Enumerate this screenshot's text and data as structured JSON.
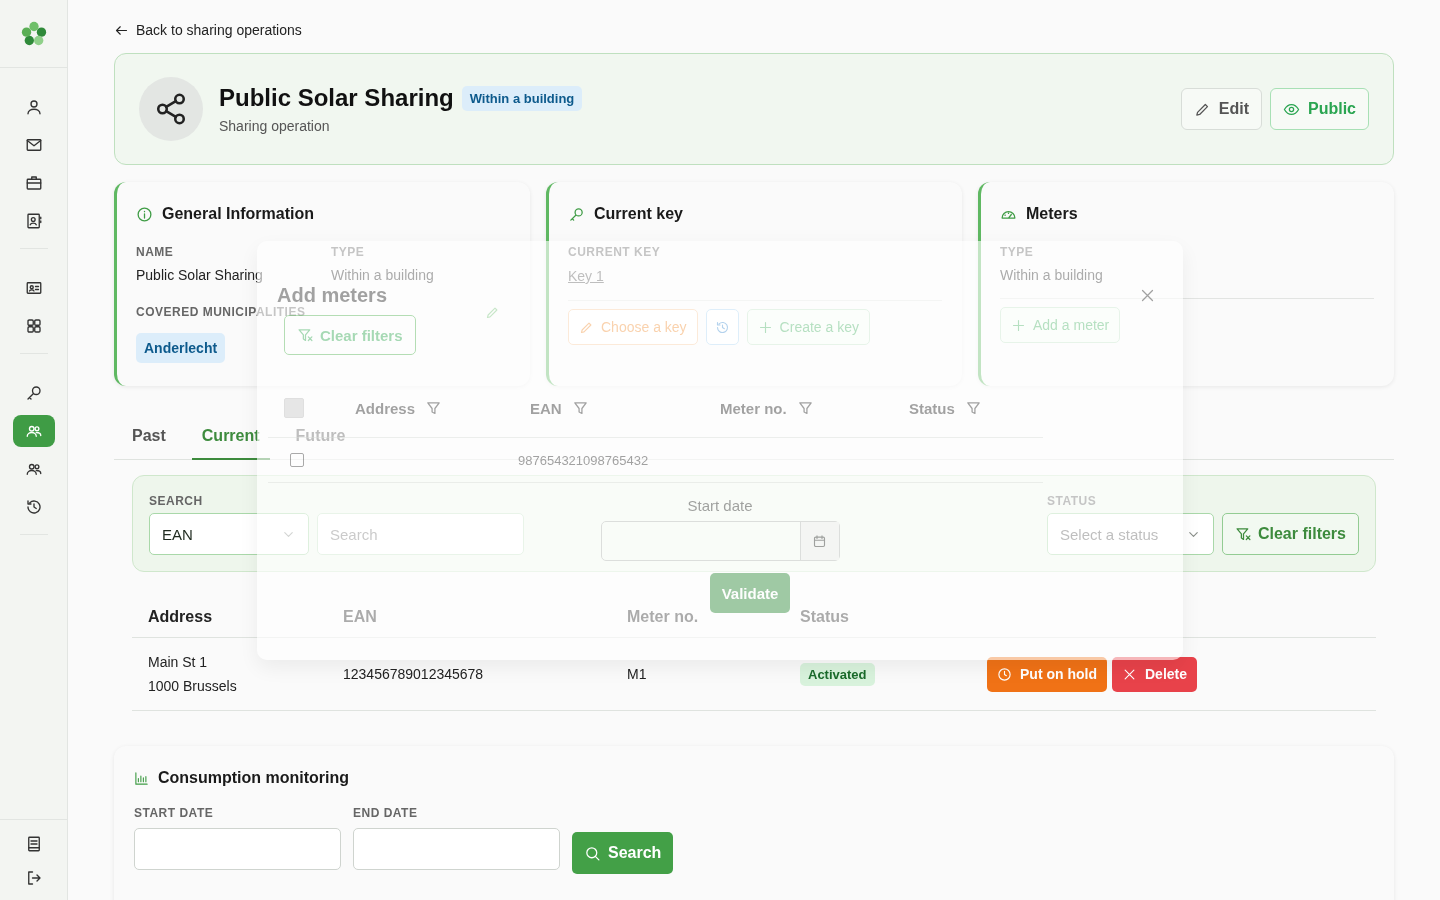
{
  "sidebar": {
    "sections": [
      {
        "items": [
          {
            "kind": "person",
            "selected": false
          },
          {
            "kind": "mail",
            "selected": false
          },
          {
            "kind": "briefcase",
            "selected": false
          },
          {
            "kind": "contacts",
            "selected": false
          }
        ]
      },
      {
        "items": [
          {
            "kind": "idcard",
            "selected": false
          },
          {
            "kind": "grid",
            "selected": false
          }
        ]
      },
      {
        "items": [
          {
            "kind": "key",
            "selected": false
          },
          {
            "kind": "group",
            "selected": true
          },
          {
            "kind": "people",
            "selected": false
          },
          {
            "kind": "history",
            "selected": false
          }
        ]
      }
    ],
    "footer_items": [
      {
        "kind": "book",
        "selected": false
      },
      {
        "kind": "logout",
        "selected": false
      }
    ]
  },
  "back_link": {
    "label": "Back to sharing operations"
  },
  "header": {
    "title": "Public Solar Sharing",
    "badge": "Within a building",
    "subtitle": "Sharing operation",
    "buttons": [
      {
        "kind": "edit",
        "label": "Edit"
      },
      {
        "kind": "public",
        "label": "Public"
      }
    ]
  },
  "general": {
    "title": "General Information",
    "fields": [
      {
        "label": "NAME",
        "value": "Public Solar Sharing"
      },
      {
        "label": "TYPE",
        "value": "Within a building"
      }
    ],
    "municipalities_label": "COVERED MUNICIPALITIES",
    "municipalities": [
      "Anderlecht"
    ]
  },
  "current_key": {
    "title": "Current key",
    "label": "CURRENT KEY",
    "key": "Key 1",
    "buttons": [
      {
        "kind": "choose",
        "label": "Choose a key"
      },
      {
        "kind": "history"
      },
      {
        "kind": "create",
        "label": "Create a key"
      }
    ]
  },
  "meters": {
    "title": "Meters",
    "label": "TYPE",
    "value": "Within a building",
    "add_button": "Add a meter"
  },
  "tabs": [
    {
      "label": "Past",
      "selected": false
    },
    {
      "label": "Current",
      "selected": true
    },
    {
      "label": "Future",
      "selected": false
    }
  ],
  "filters": {
    "search_label": "SEARCH",
    "search_select": {
      "value": "EAN"
    },
    "search_input": {
      "placeholder": "Search"
    },
    "status_label": "STATUS",
    "status_select": {
      "placeholder": "Select a status"
    },
    "clear_button": "Clear filters"
  },
  "table": {
    "columns": [
      "Address",
      "EAN",
      "Meter no.",
      "Status"
    ],
    "rows": [
      {
        "address": [
          "Main St 1",
          "1000 Brussels"
        ],
        "ean": "123456789012345678",
        "meter_no": "M1",
        "status": "Activated",
        "actions": [
          {
            "kind": "hold",
            "label": "Put on hold"
          },
          {
            "kind": "delete",
            "label": "Delete"
          }
        ]
      }
    ]
  },
  "consumption": {
    "title": "Consumption monitoring",
    "start_label": "START DATE",
    "end_label": "END DATE",
    "search_button": "Search"
  },
  "modal": {
    "title": "Add meters",
    "clear_button": "Clear filters",
    "select_all": {
      "checked": false
    },
    "columns": [
      "Address",
      "EAN",
      "Meter no.",
      "Status"
    ],
    "rows": [
      {
        "checked": false,
        "ean": "987654321098765432"
      }
    ],
    "start_date_label": "Start date",
    "validate_button": "Validate"
  }
}
